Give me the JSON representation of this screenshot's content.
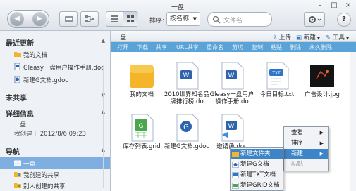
{
  "window": {
    "title": "一盘",
    "controls": [
      "–",
      "□",
      "×"
    ]
  },
  "toolbar": {
    "sort_label": "排序:",
    "sort_value": "按名称",
    "search_placeholder": "文件名",
    "help_label": "?"
  },
  "sidebar": {
    "recent": {
      "title": "最近更新",
      "items": [
        {
          "label": "我的文档",
          "icon": "folder-icon"
        },
        {
          "label": "Gleasy一盘用户操作手册.doc",
          "icon": "doc-icon"
        },
        {
          "label": "新建G文档.gdoc",
          "icon": "gdoc-icon"
        }
      ]
    },
    "shared": {
      "title": "未共享"
    },
    "details": {
      "title": "详细信息",
      "name": "一盘",
      "created": "我创建于 2012/8/6 09:23"
    },
    "nav": {
      "title": "导航",
      "items": [
        {
          "label": "一盘",
          "icon": "disk-icon",
          "selected": true
        },
        {
          "label": "我创建的共享",
          "icon": "share-out-icon"
        },
        {
          "label": "别人创建的共享",
          "icon": "share-in-icon"
        }
      ]
    }
  },
  "content": {
    "breadcrumb": "一盘",
    "actions": {
      "upload": "上传",
      "new": "新建",
      "tools": "工具"
    },
    "ops": [
      "打开",
      "下载",
      "共享",
      "URL共享",
      "重命名",
      "剪切",
      "复制",
      "粘贴",
      "删除",
      "永久删除"
    ],
    "files": [
      {
        "name": "我的文档",
        "icon": "folder-icon"
      },
      {
        "name": "2010世界知名品牌排行榜.do",
        "icon": "word-doc-icon"
      },
      {
        "name": "Gleasy一盘用户操作手册.do",
        "icon": "word-doc-icon"
      },
      {
        "name": "今日目标.txt",
        "icon": "txt-icon"
      },
      {
        "name": "广告设计.jpg",
        "icon": "image-thumbnail-icon"
      },
      {
        "name": "库存列表.grid",
        "icon": "grid-icon"
      },
      {
        "name": "新建G文档.gdoc",
        "icon": "gdoc-icon"
      },
      {
        "name": "邀请函.doc",
        "icon": "word-doc-icon"
      }
    ]
  },
  "context_menu": {
    "items": [
      {
        "label": "查看",
        "submenu": true
      },
      {
        "label": "排序",
        "submenu": true
      },
      {
        "label": "新建",
        "submenu": true,
        "highlighted": true
      },
      {
        "label": "粘贴",
        "disabled": true
      }
    ],
    "submenu": [
      {
        "label": "新建文件夹",
        "icon": "folder-icon",
        "highlighted": true
      },
      {
        "label": "新建G文档",
        "icon": "gdoc-icon"
      },
      {
        "label": "新建TXT文档",
        "icon": "txt-icon"
      },
      {
        "label": "新建GRID文档",
        "icon": "grid-icon"
      }
    ]
  },
  "colors": {
    "accent": "#5aa3d8",
    "selection": "#7faee0",
    "highlight": "#3d85c6",
    "folder": "#f5b52a"
  }
}
